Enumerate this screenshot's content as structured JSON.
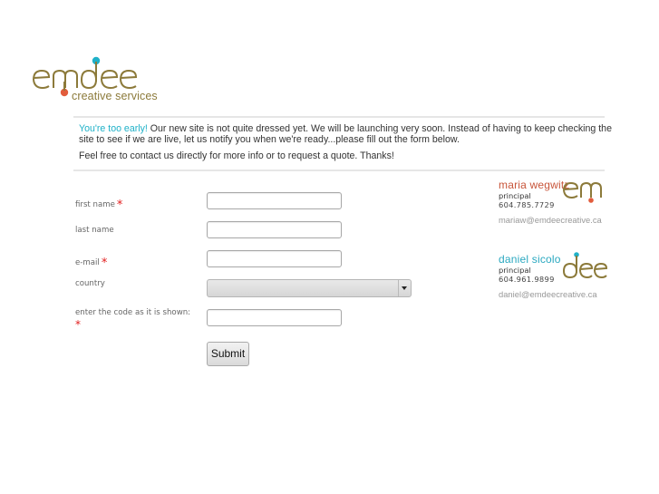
{
  "brand": {
    "logo_text": "emdee",
    "tagline": "creative services",
    "colors": {
      "gold": "#8c7a3a",
      "teal": "#1fb1c8",
      "coral": "#e25c3c",
      "required": "#e21c1c"
    }
  },
  "intro": {
    "highlight": "You're too early!",
    "paragraph1": " Our new site is not quite dressed yet. We will be launching very soon. Instead of having to keep checking the site to see if we are live, let us notify you when we're ready...please fill out the form below.",
    "paragraph2": "Feel free to contact us directly for more info or to request a quote. Thanks!"
  },
  "form": {
    "fields": [
      {
        "label": "first name",
        "required": true,
        "value": ""
      },
      {
        "label": "last name",
        "required": false,
        "value": ""
      },
      {
        "label": "e-mail",
        "required": true,
        "value": ""
      },
      {
        "label": "country",
        "required": false,
        "selected": ""
      },
      {
        "label": "enter the code as it is shown:",
        "required": true,
        "value": ""
      }
    ],
    "required_marker": "*",
    "submit_label": "Submit"
  },
  "contacts": [
    {
      "name": "maria wegwitz",
      "role": "principal",
      "phone": "604.785.7729",
      "email": "mariaw@emdeecreative.ca",
      "monogram": "em",
      "name_color": "#c8553a"
    },
    {
      "name": "daniel sicolo",
      "role": "principal",
      "phone": "604.961.9899",
      "email": "daniel@emdeecreative.ca",
      "monogram": "dee",
      "name_color": "#2aa8c0"
    }
  ]
}
